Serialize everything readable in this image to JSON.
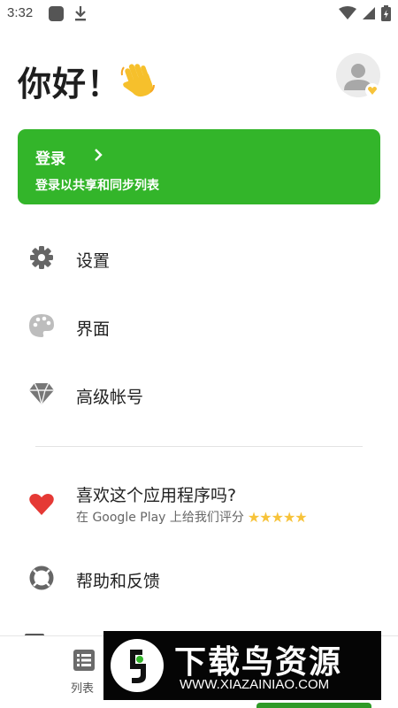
{
  "status_bar": {
    "time": "3:32"
  },
  "header": {
    "greeting": "你好！",
    "avatar_alt": "avatar"
  },
  "login_card": {
    "title": "登录",
    "subtitle": "登录以共享和同步列表"
  },
  "menu": {
    "settings": "设置",
    "interface": "界面",
    "premium": "高级帐号",
    "rate_title": "喜欢这个应用程序吗?",
    "rate_subtitle": "在 Google Play 上给我们评分",
    "rate_stars": "★★★★★",
    "help": "帮助和反馈"
  },
  "bottom_nav": {
    "list_label": "列表"
  },
  "watermark": {
    "title": "下载鸟资源",
    "url": "WWW.XIAZAINIAO.COM"
  },
  "colors": {
    "accent": "#33b52a",
    "heart": "#e53935",
    "star": "#f7c33a"
  }
}
